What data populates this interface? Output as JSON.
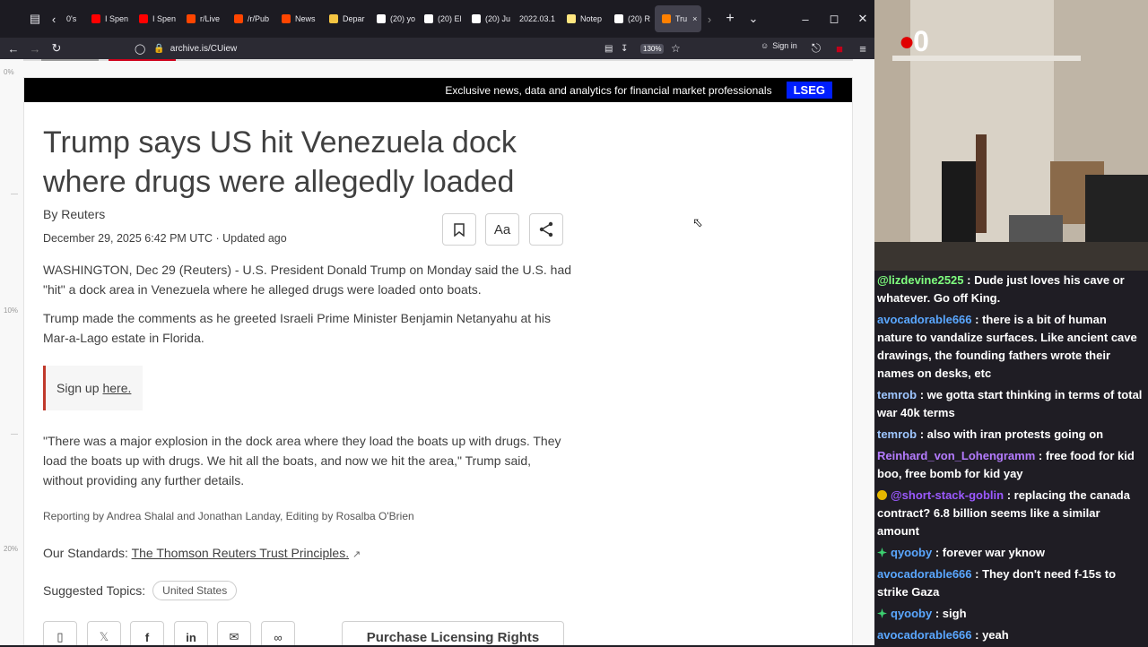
{
  "browser": {
    "tabs": [
      {
        "label": "0's",
        "fav": "",
        "color": "#888"
      },
      {
        "label": "I Spen",
        "fav": "youtube-icon",
        "color": "#ff0000"
      },
      {
        "label": "I Spen",
        "fav": "youtube-icon",
        "color": "#ff0000"
      },
      {
        "label": "r/Live",
        "fav": "reddit-icon",
        "color": "#ff4500"
      },
      {
        "label": "/r/Pub",
        "fav": "reddit-icon",
        "color": "#ff4500"
      },
      {
        "label": "News",
        "fav": "reddit-icon",
        "color": "#ff4500"
      },
      {
        "label": "Depar",
        "fav": "globe-icon",
        "color": "#f5c542"
      },
      {
        "label": "(20) yo",
        "fav": "x-icon",
        "color": "#ffffff"
      },
      {
        "label": "(20) El",
        "fav": "x-icon",
        "color": "#ffffff"
      },
      {
        "label": "(20) Ju",
        "fav": "x-icon",
        "color": "#ffffff"
      },
      {
        "label": "2022.03.1",
        "fav": "",
        "color": "#888"
      },
      {
        "label": "Notep",
        "fav": "notepad-icon",
        "color": "#ffe680"
      },
      {
        "label": "(20) R",
        "fav": "x-icon",
        "color": "#ffffff"
      },
      {
        "label": "Tru",
        "fav": "reuters-icon",
        "color": "#ff8000",
        "active": true
      }
    ],
    "url": "archive.is/CUiew",
    "zoom": "130%",
    "sign_in": "Sign in"
  },
  "page": {
    "ruler_labels": [
      "0%",
      "10%",
      "20%"
    ],
    "lseg_banner": "Exclusive news, data and analytics for financial market professionals",
    "lseg_logo": "LSEG",
    "headline": "Trump says US hit Venezuela dock where drugs were allegedly loaded",
    "byline": "By Reuters",
    "dateline": "December 29, 2025 6:42 PM UTC · Updated ago",
    "tool_aa": "Aa",
    "para1": "WASHINGTON, Dec 29 (Reuters) - U.S. President Donald Trump on Monday said the U.S. had \"hit\" a dock area in Venezuela where he alleged drugs were loaded onto boats.",
    "para2": "Trump made the comments as he greeted Israeli Prime Minister Benjamin Netanyahu at his Mar-a-Lago estate in Florida.",
    "signup_text": "Sign up",
    "signup_link": "here.",
    "para3": "\"There was a major explosion in the dock area where they load the boats up with drugs. They load the boats up with drugs. We hit all the boats, and now we hit the area,\" Trump said, without providing any further details.",
    "credits": "Reporting by Andrea Shalal and Jonathan Landay, Editing by Rosalba O'Brien",
    "standards_label": "Our Standards:",
    "standards_link": "The Thomson Reuters Trust Principles.",
    "topics_label": "Suggested Topics:",
    "topic": "United States",
    "license_button": "Purchase Licensing Rights"
  },
  "overlay": {
    "counter": "0",
    "chat": [
      {
        "user": "@lizdevine2525",
        "color": "#7fff7f",
        "text": ": Dude just loves his cave or whatever. Go off King.",
        "badge": ""
      },
      {
        "user": "avocadorable666",
        "color": "#5aa7ff",
        "text": ": there is a bit of human nature to vandalize surfaces. Like ancient cave drawings, the founding fathers wrote their names on desks, etc",
        "badge": ""
      },
      {
        "user": "temrob",
        "color": "#9ec6ff",
        "text": ": we gotta start thinking in terms of total war 40k terms",
        "badge": ""
      },
      {
        "user": "temrob",
        "color": "#9ec6ff",
        "text": ": also with iran protests going on",
        "badge": ""
      },
      {
        "user": "Reinhard_von_Lohengramm",
        "color": "#b57cff",
        "text": ": free food for kid boo, free bomb for kid yay",
        "badge": ""
      },
      {
        "user": "@short-stack-goblin",
        "color": "#9b59ff",
        "text": ": replacing the canada contract? 6.8 billion seems like a similar amount",
        "badge": "coin"
      },
      {
        "user": "qyooby",
        "color": "#5aa7ff",
        "text": ": forever war yknow",
        "badge": "sparkle"
      },
      {
        "user": "avocadorable666",
        "color": "#5aa7ff",
        "text": ": They don't need f-15s to strike Gaza",
        "badge": ""
      },
      {
        "user": "qyooby",
        "color": "#5aa7ff",
        "text": ": sigh",
        "badge": "sparkle"
      },
      {
        "user": "avocadorable666",
        "color": "#5aa7ff",
        "text": ": yeah",
        "badge": ""
      }
    ]
  }
}
